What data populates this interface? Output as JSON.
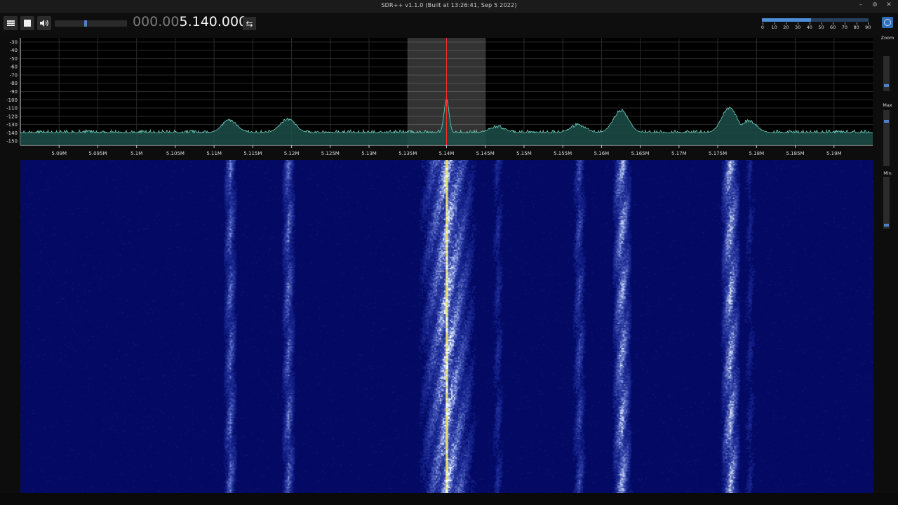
{
  "window": {
    "title": "SDR++ v1.1.0 (Built at 13:26:41, Sep  5 2022)",
    "controls": [
      "–",
      "⊚",
      "✕"
    ]
  },
  "toolbar": {
    "menu_icon": "hamburger-icon",
    "play_icon": "stop-square-icon",
    "volume_icon": "speaker-icon",
    "volume_level": 0.42,
    "freq_dim": "000.00",
    "freq_bright": "5.140.000",
    "tune_mode_icon": "swap-arrows-icon",
    "tune_mode_glyph": "⇆",
    "snr_level": 0.46,
    "snr_labels": [
      "0",
      "10",
      "20",
      "30",
      "40",
      "50",
      "60",
      "70",
      "80",
      "90"
    ],
    "accent": "#4a83c9"
  },
  "sidebar": {
    "zoom_label": "Zoom",
    "max_label": "Max",
    "min_label": "Min",
    "zoom_level": 0.13,
    "max_level": 0.82,
    "min_level": 0.05
  },
  "chart_data": {
    "type": "line",
    "x_unit": "Hz",
    "xlim": [
      5085000,
      5195000
    ],
    "ylim": [
      -155,
      -25
    ],
    "y_ticks": [
      -30,
      -40,
      -50,
      -60,
      -70,
      -80,
      -90,
      -100,
      -110,
      -120,
      -130,
      -140,
      -150
    ],
    "x_ticks": [
      5090000,
      5095000,
      5100000,
      5105000,
      5110000,
      5115000,
      5120000,
      5125000,
      5130000,
      5135000,
      5140000,
      5145000,
      5150000,
      5155000,
      5160000,
      5165000,
      5170000,
      5175000,
      5180000,
      5185000,
      5190000
    ],
    "x_tick_labels": [
      "5.09M",
      "5.095M",
      "5.1M",
      "5.105M",
      "5.11M",
      "5.115M",
      "5.12M",
      "5.125M",
      "5.13M",
      "5.135M",
      "5.14M",
      "5.145M",
      "5.15M",
      "5.155M",
      "5.16M",
      "5.165M",
      "5.17M",
      "5.175M",
      "5.18M",
      "5.185M",
      "5.19M"
    ],
    "vfo": {
      "center": 5140000,
      "low": 5135000,
      "high": 5145000
    },
    "noise_floor": -140,
    "peaks": [
      {
        "x": 5112000,
        "y": -125
      },
      {
        "x": 5119500,
        "y": -123
      },
      {
        "x": 5140000,
        "y": -99
      },
      {
        "x": 5146500,
        "y": -132
      },
      {
        "x": 5157000,
        "y": -130
      },
      {
        "x": 5162500,
        "y": -113
      },
      {
        "x": 5176500,
        "y": -110
      },
      {
        "x": 5179000,
        "y": -125
      }
    ],
    "signal_bands": [
      {
        "x": 5112000,
        "strength": 0.6
      },
      {
        "x": 5119500,
        "strength": 0.6
      },
      {
        "x": 5140000,
        "strength": 0.9
      },
      {
        "x": 5146500,
        "strength": 0.3
      },
      {
        "x": 5157000,
        "strength": 0.45
      },
      {
        "x": 5162500,
        "strength": 0.85
      },
      {
        "x": 5176500,
        "strength": 0.9
      },
      {
        "x": 5179000,
        "strength": 0.25
      }
    ],
    "line_color": "#6fcfbd",
    "fill_color": "#1c4e48",
    "waterfall_bg": "#040a63"
  }
}
